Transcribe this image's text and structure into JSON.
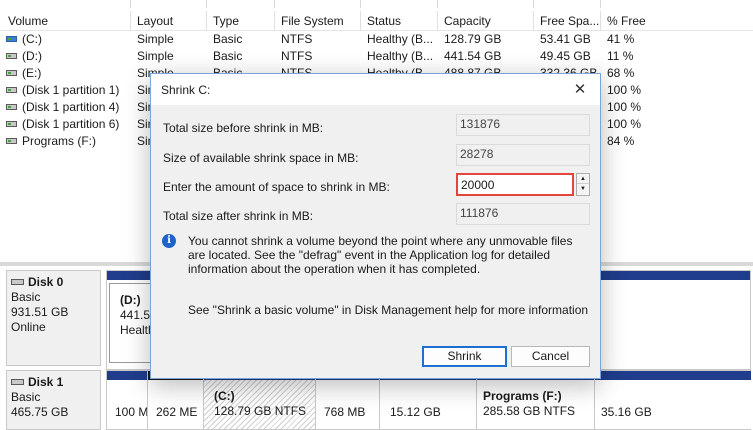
{
  "table": {
    "columns": [
      "Volume",
      "Layout",
      "Type",
      "File System",
      "Status",
      "Capacity",
      "Free Spa...",
      "% Free"
    ],
    "rows": [
      {
        "volume": "(C:)",
        "layout": "Simple",
        "type": "Basic",
        "fs": "NTFS",
        "status": "Healthy (B...",
        "capacity": "128.79 GB",
        "free": "53.41 GB",
        "pct": "41 %",
        "icon": "volume-blue"
      },
      {
        "volume": "(D:)",
        "layout": "Simple",
        "type": "Basic",
        "fs": "NTFS",
        "status": "Healthy (B...",
        "capacity": "441.54 GB",
        "free": "49.45 GB",
        "pct": "11 %",
        "icon": "volume"
      },
      {
        "volume": "(E:)",
        "layout": "Simple",
        "type": "Basic",
        "fs": "NTFS",
        "status": "Healthy (B...",
        "capacity": "488.87 GB",
        "free": "332.36 GB",
        "pct": "68 %",
        "icon": "volume"
      },
      {
        "volume": "(Disk 1 partition 1)",
        "layout": "Simple",
        "type": "",
        "fs": "",
        "status": "",
        "capacity": "",
        "free": "",
        "pct": "100 %",
        "icon": "volume"
      },
      {
        "volume": "(Disk 1 partition 4)",
        "layout": "Simple",
        "type": "",
        "fs": "",
        "status": "",
        "capacity": "",
        "free": "",
        "pct": "100 %",
        "icon": "volume"
      },
      {
        "volume": "(Disk 1 partition 6)",
        "layout": "Simple",
        "type": "",
        "fs": "",
        "status": "",
        "capacity": "",
        "free": "",
        "pct": "100 %",
        "icon": "volume"
      },
      {
        "volume": "Programs (F:)",
        "layout": "Simple",
        "type": "",
        "fs": "",
        "status": "",
        "capacity": "",
        "free": "",
        "pct": "84 %",
        "icon": "volume"
      }
    ]
  },
  "disks": [
    {
      "name": "Disk 0",
      "type": "Basic",
      "size": "931.51 GB",
      "state": "Online",
      "partitions": [
        {
          "title": "(D:)",
          "line2": "441.54",
          "line3": "Healthy"
        }
      ]
    },
    {
      "name": "Disk 1",
      "type": "Basic",
      "size": "465.75 GB",
      "partitions": [
        {
          "line2": "100 M"
        },
        {
          "line2": "262 ME"
        },
        {
          "title": "(C:)",
          "line2": "128.79 GB NTFS"
        },
        {
          "line2": "768 MB"
        },
        {
          "line2": "15.12 GB"
        },
        {
          "title": "Programs  (F:)",
          "line2": "285.58 GB NTFS"
        },
        {
          "line2": "35.16 GB"
        }
      ]
    }
  ],
  "dialog": {
    "title": "Shrink C:",
    "close_icon": "close-icon",
    "total_before_label": "Total size before shrink in MB:",
    "total_before_value": "131876",
    "available_label": "Size of available shrink space in MB:",
    "available_value": "28278",
    "enter_label": "Enter the amount of space to shrink in MB:",
    "enter_value": "20000",
    "total_after_label": "Total size after shrink in MB:",
    "total_after_value": "111876",
    "info_text": "You cannot shrink a volume beyond the point where any unmovable files are located. See the \"defrag\" event in the Application log for detailed information about the operation when it has completed.",
    "help_text": "See \"Shrink a basic volume\" in Disk Management help for more information",
    "shrink_button": "Shrink",
    "cancel_button": "Cancel"
  },
  "colors": {
    "primary_partition_bar": "#1f3d8c",
    "unallocated_bar": "#1a1a1a",
    "focus_border": "#1f6fd1",
    "input_error_border": "#e2453b",
    "info_icon": "#1e64c8"
  }
}
